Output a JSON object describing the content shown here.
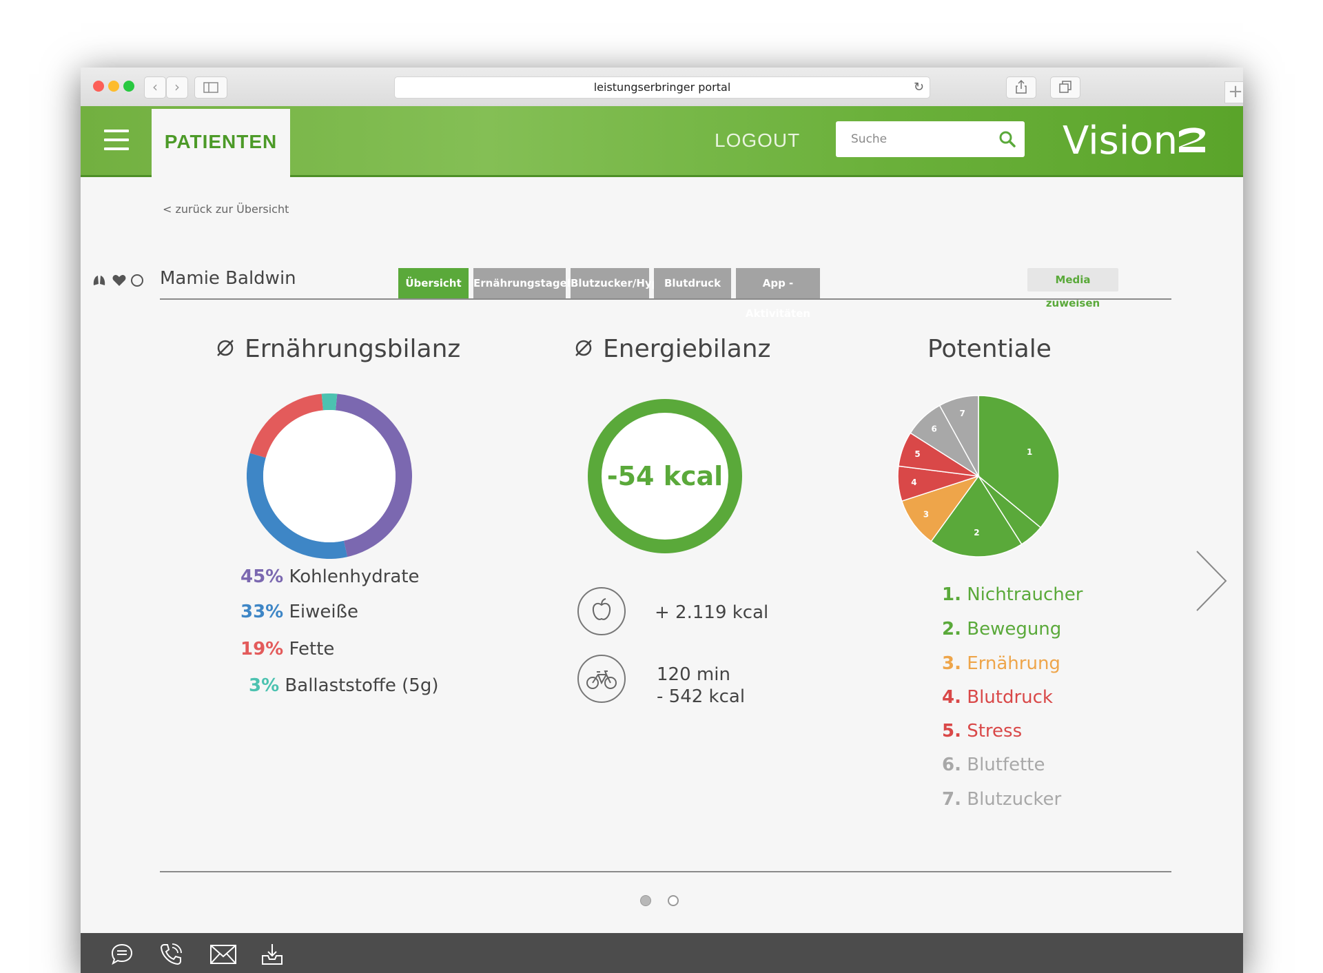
{
  "browser": {
    "url": "leistungserbringer portal"
  },
  "header": {
    "nav_tab": "PATIENTEN",
    "logout": "LOGOUT",
    "search_placeholder": "Suche",
    "logo": "Vision"
  },
  "back_link": "< zurück zur Übersicht",
  "patient": {
    "name": "Mamie Baldwin"
  },
  "tabs": [
    {
      "label": "Übersicht",
      "active": true
    },
    {
      "label": "Ernährungstagebuch",
      "active": false
    },
    {
      "label": "Blutzucker/Hypo",
      "active": false
    },
    {
      "label": "Blutdruck",
      "active": false
    },
    {
      "label": "App - Aktivitäten",
      "active": false
    }
  ],
  "media_button": "Media zuweisen",
  "ernaehrung": {
    "title": "Ernährungsbilanz",
    "items": [
      {
        "pct": "45%",
        "label": "Kohlenhydrate",
        "value": 45,
        "color": "#7b68b0"
      },
      {
        "pct": "33%",
        "label": "Eiweiße",
        "value": 33,
        "color": "#3e86c6"
      },
      {
        "pct": "19%",
        "label": "Fette",
        "value": 19,
        "color": "#e35b5b"
      },
      {
        "pct": "3%",
        "label": "Ballaststoffe (5g)",
        "value": 3,
        "color": "#4cc2b0"
      }
    ]
  },
  "energie": {
    "title": "Energiebilanz",
    "balance": "-54 kcal",
    "intake": "+ 2.119 kcal",
    "activity_time": "120 min",
    "activity_kcal": "- 542 kcal",
    "color": "#5aa93a"
  },
  "potentiale": {
    "title": "Potentiale",
    "items": [
      {
        "num": "1.",
        "label": "Nichtraucher",
        "color": "#5aa93a"
      },
      {
        "num": "2.",
        "label": "Bewegung",
        "color": "#5aa93a"
      },
      {
        "num": "3.",
        "label": "Ernährung",
        "color": "#eea54a"
      },
      {
        "num": "4.",
        "label": "Blutdruck",
        "color": "#d94848"
      },
      {
        "num": "5.",
        "label": "Stress",
        "color": "#d94848"
      },
      {
        "num": "6.",
        "label": "Blutfette",
        "color": "#a8a8a8"
      },
      {
        "num": "7.",
        "label": "Blutzucker",
        "color": "#a8a8a8"
      }
    ],
    "pie": [
      {
        "label": "1",
        "value": 36,
        "color": "#5aa93a"
      },
      {
        "label": "",
        "value": 5,
        "color": "#5aa93a"
      },
      {
        "label": "2",
        "value": 19,
        "color": "#5aa93a"
      },
      {
        "label": "3",
        "value": 10,
        "color": "#eea54a"
      },
      {
        "label": "4",
        "value": 7,
        "color": "#d94848"
      },
      {
        "label": "5",
        "value": 7,
        "color": "#d94848"
      },
      {
        "label": "6",
        "value": 8,
        "color": "#a8a8a8"
      },
      {
        "label": "7",
        "value": 8,
        "color": "#a8a8a8"
      }
    ]
  },
  "pagination": {
    "pages": 2,
    "current": 1
  }
}
